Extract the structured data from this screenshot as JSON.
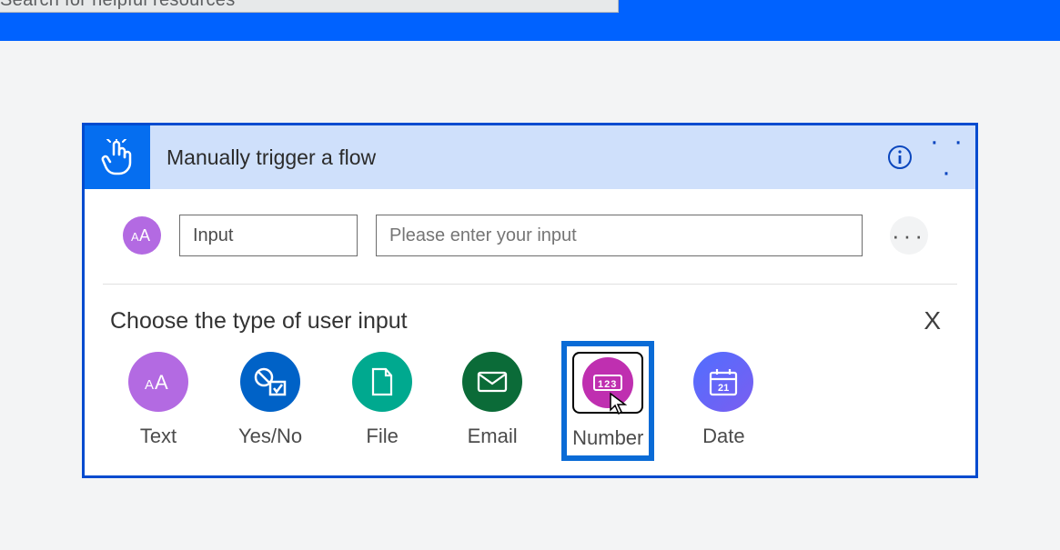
{
  "search": {
    "placeholder": "Search for helpful resources"
  },
  "trigger": {
    "title": "Manually trigger a flow",
    "input_name": "Input",
    "input_desc_placeholder": "Please enter your input"
  },
  "choose": {
    "heading": "Choose the type of user input",
    "types": [
      {
        "id": "text",
        "label": "Text"
      },
      {
        "id": "yesno",
        "label": "Yes/No"
      },
      {
        "id": "file",
        "label": "File"
      },
      {
        "id": "email",
        "label": "Email"
      },
      {
        "id": "number",
        "label": "Number"
      },
      {
        "id": "date",
        "label": "Date"
      }
    ],
    "calendar_day": "21"
  }
}
